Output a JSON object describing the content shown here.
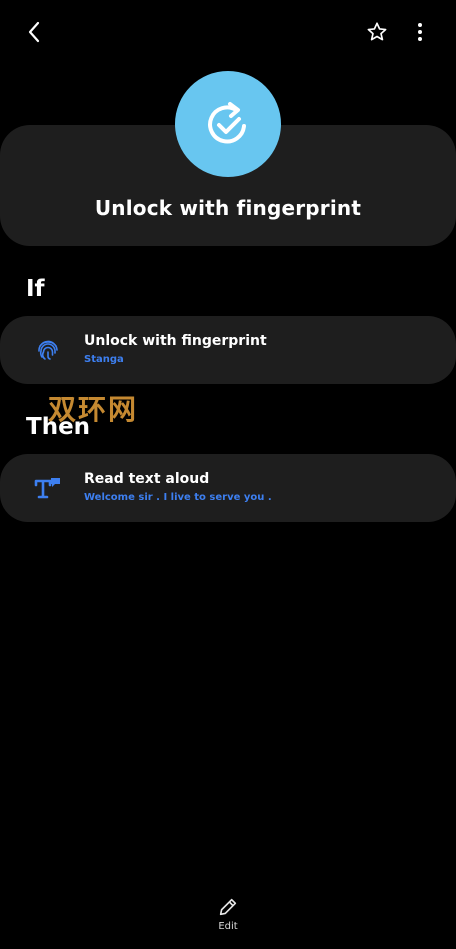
{
  "header": {
    "back_icon": "back-arrow-icon",
    "favorite_icon": "star-outline-icon",
    "more_icon": "more-vertical-icon"
  },
  "hero": {
    "title": "Unlock with fingerprint",
    "icon": "check-cycle-icon",
    "icon_color": "#68c6f0"
  },
  "if_section": {
    "label": "If",
    "item": {
      "icon": "fingerprint-icon",
      "title": "Unlock with fingerprint",
      "subtitle": "Stanga"
    }
  },
  "watermark": {
    "text": "双环网"
  },
  "then_section": {
    "label": "Then",
    "item": {
      "icon": "text-to-speech-icon",
      "title": "Read text aloud",
      "subtitle": "Welcome sir . I live to serve you ."
    }
  },
  "bottom_bar": {
    "edit_label": "Edit",
    "edit_icon": "pencil-icon"
  },
  "colors": {
    "background": "#000000",
    "card": "#1e1e1e",
    "accent": "#3d7ff0",
    "hero_circle": "#68c6f0"
  }
}
